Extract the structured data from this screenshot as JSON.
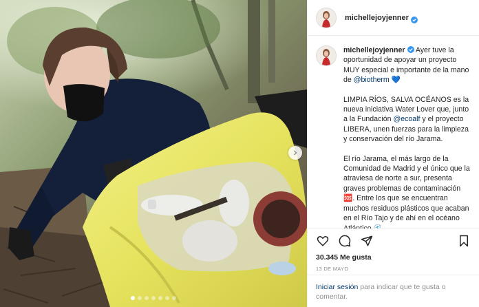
{
  "profile": {
    "username": "michellejoyjenner",
    "verified": true
  },
  "caption": {
    "author": "michellejoyjenner",
    "p1_intro": "Ayer tuve la oportunidad de apoyar un proyecto MUY especial e importante de la mano de ",
    "p1_mention": "@biotherm",
    "p1_emoji": "💙",
    "p2_a": "LIMPIA RÍOS, SALVA OCÉANOS es la nueva iniciativa Water Lover que, junto a la Fundación ",
    "p2_mention": "@ecoalf",
    "p2_b": " y el proyecto LIBERA, unen fuerzas para la limpieza y conservación del río Jarama.",
    "p3_a": "El río Jarama, el más largo de la Comunidad de Madrid y el único que la atraviesa de norte a sur, presenta graves problemas de contaminación ",
    "p3_emoji": "🆘",
    "p3_b": ". Entre los que se encuentran muchos residuos plásticos que acaban en el Río Tajo y de ahí en el océano Atlántico ",
    "p3_emoji2": "🌊"
  },
  "actions": {
    "like_icon": "heart-icon",
    "comment_icon": "comment-icon",
    "share_icon": "share-icon",
    "save_icon": "bookmark-icon"
  },
  "likes": "30.345 Me gusta",
  "date": "13 DE MAYO",
  "login": {
    "link": "Iniciar sesión",
    "rest": " para indicar que te gusta o comentar."
  },
  "carousel": {
    "count": 7,
    "active": 0
  },
  "colors": {
    "verified": "#3897f0",
    "link": "#00376b",
    "muted": "#8e8e8e"
  }
}
